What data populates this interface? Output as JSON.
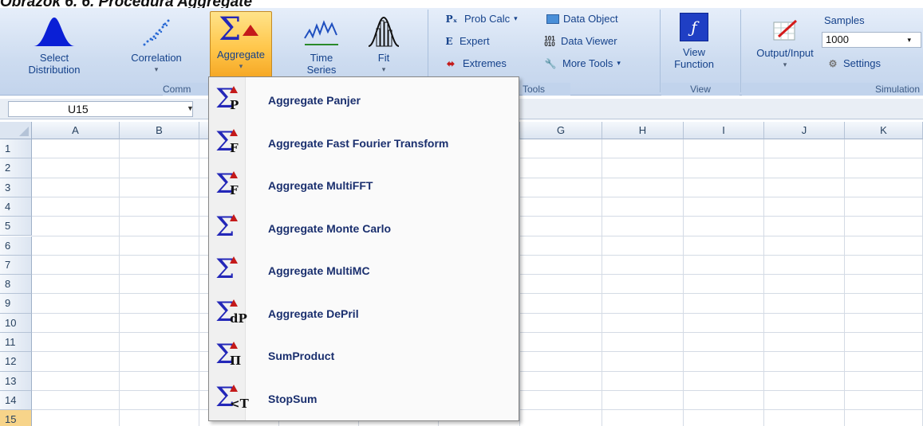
{
  "caption": "Obrázok 6. 6. Procedura Aggregate",
  "ribbon": {
    "buttons": {
      "select_distribution": "Select\nDistribution",
      "correlation": "Correlation",
      "aggregate": "Aggregate",
      "time_series": "Time\nSeries",
      "fit": "Fit",
      "view_function": "View\nFunction",
      "output_input": "Output/Input"
    },
    "tools": {
      "prob_calc": "Prob Calc",
      "expert": "Expert",
      "extremes": "Extremes",
      "data_object": "Data Object",
      "data_viewer": "Data Viewer",
      "more_tools": "More Tools"
    },
    "simulation": {
      "samples_label": "Samples",
      "samples_value": "1000",
      "settings": "Settings"
    },
    "groups": {
      "commands": "Comm",
      "tools": "Tools",
      "view": "View",
      "simulation": "Simulation"
    }
  },
  "formula_bar": {
    "name_box": "U15"
  },
  "grid": {
    "columns": [
      "A",
      "B",
      "G",
      "H",
      "I",
      "J",
      "K"
    ],
    "rows": [
      "1",
      "2",
      "3",
      "4",
      "5",
      "6",
      "7",
      "8",
      "9",
      "10",
      "11",
      "12",
      "13",
      "14",
      "15"
    ]
  },
  "menu": {
    "items": [
      {
        "label": "Aggregate Panjer",
        "sub": "P",
        "icon": "aggregate-panjer-icon"
      },
      {
        "label": "Aggregate Fast Fourier Transform",
        "sub": "F",
        "icon": "aggregate-fft-icon"
      },
      {
        "label": "Aggregate MultiFFT",
        "sub": "F",
        "icon": "aggregate-multifft-icon"
      },
      {
        "label": "Aggregate Monte Carlo",
        "sub": "",
        "icon": "aggregate-montecarlo-icon"
      },
      {
        "label": "Aggregate MultiMC",
        "sub": "",
        "icon": "aggregate-multimc-icon"
      },
      {
        "label": "Aggregate DePril",
        "sub": "dP",
        "icon": "aggregate-depril-icon"
      },
      {
        "label": "SumProduct",
        "sub": "Π",
        "icon": "sumproduct-icon"
      },
      {
        "label": "StopSum",
        "sub": "<T",
        "icon": "stopsum-icon"
      }
    ]
  },
  "colors": {
    "accent": "#2327b8",
    "ribbon": "#cddcf0",
    "active": "#ffc64a"
  }
}
